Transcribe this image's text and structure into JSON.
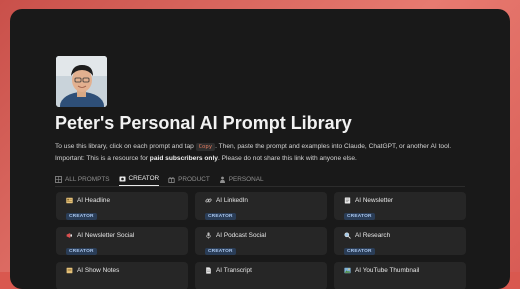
{
  "page": {
    "title": "Peter's Personal AI Prompt Library",
    "intro_line1_before": "To use this library, click on each prompt and tap ",
    "intro_code": "Copy",
    "intro_line1_after": ". Then, paste the prompt and examples into Claude, ChatGPT, or another AI tool.",
    "intro_line2_before": "Important: This is a resource for ",
    "intro_line2_bold": "paid subscribers only",
    "intro_line2_after": ". Please do not share this link with anyone else."
  },
  "tabs": [
    {
      "label": "ALL PROMPTS",
      "icon": "grid-icon",
      "active": false
    },
    {
      "label": "CREATOR",
      "icon": "camera-icon",
      "active": true
    },
    {
      "label": "PRODUCT",
      "icon": "gift-icon",
      "active": false
    },
    {
      "label": "PERSONAL",
      "icon": "person-icon",
      "active": false
    }
  ],
  "cards": [
    {
      "title": "AI Headline",
      "icon": "newspaper-icon",
      "tag": "CREATOR"
    },
    {
      "title": "AI LinkedIn",
      "icon": "link-icon",
      "tag": "CREATOR"
    },
    {
      "title": "AI Newsletter",
      "icon": "notepad-icon",
      "tag": "CREATOR"
    },
    {
      "title": "AI Newsletter Social",
      "icon": "megaphone-icon",
      "tag": "CREATOR"
    },
    {
      "title": "AI Podcast Social",
      "icon": "microphone-icon",
      "tag": "CREATOR"
    },
    {
      "title": "AI Research",
      "icon": "magnifier-icon",
      "tag": "CREATOR"
    },
    {
      "title": "AI Show Notes",
      "icon": "notes-icon",
      "tag": ""
    },
    {
      "title": "AI Transcript",
      "icon": "document-icon",
      "tag": ""
    },
    {
      "title": "AI YouTube Thumbnail",
      "icon": "image-icon",
      "tag": ""
    }
  ],
  "colors": {
    "background": "#191919",
    "card": "#262626",
    "badge_bg": "#2a3d57",
    "badge_text": "#a9c6ee",
    "frame": "#d9584f"
  }
}
